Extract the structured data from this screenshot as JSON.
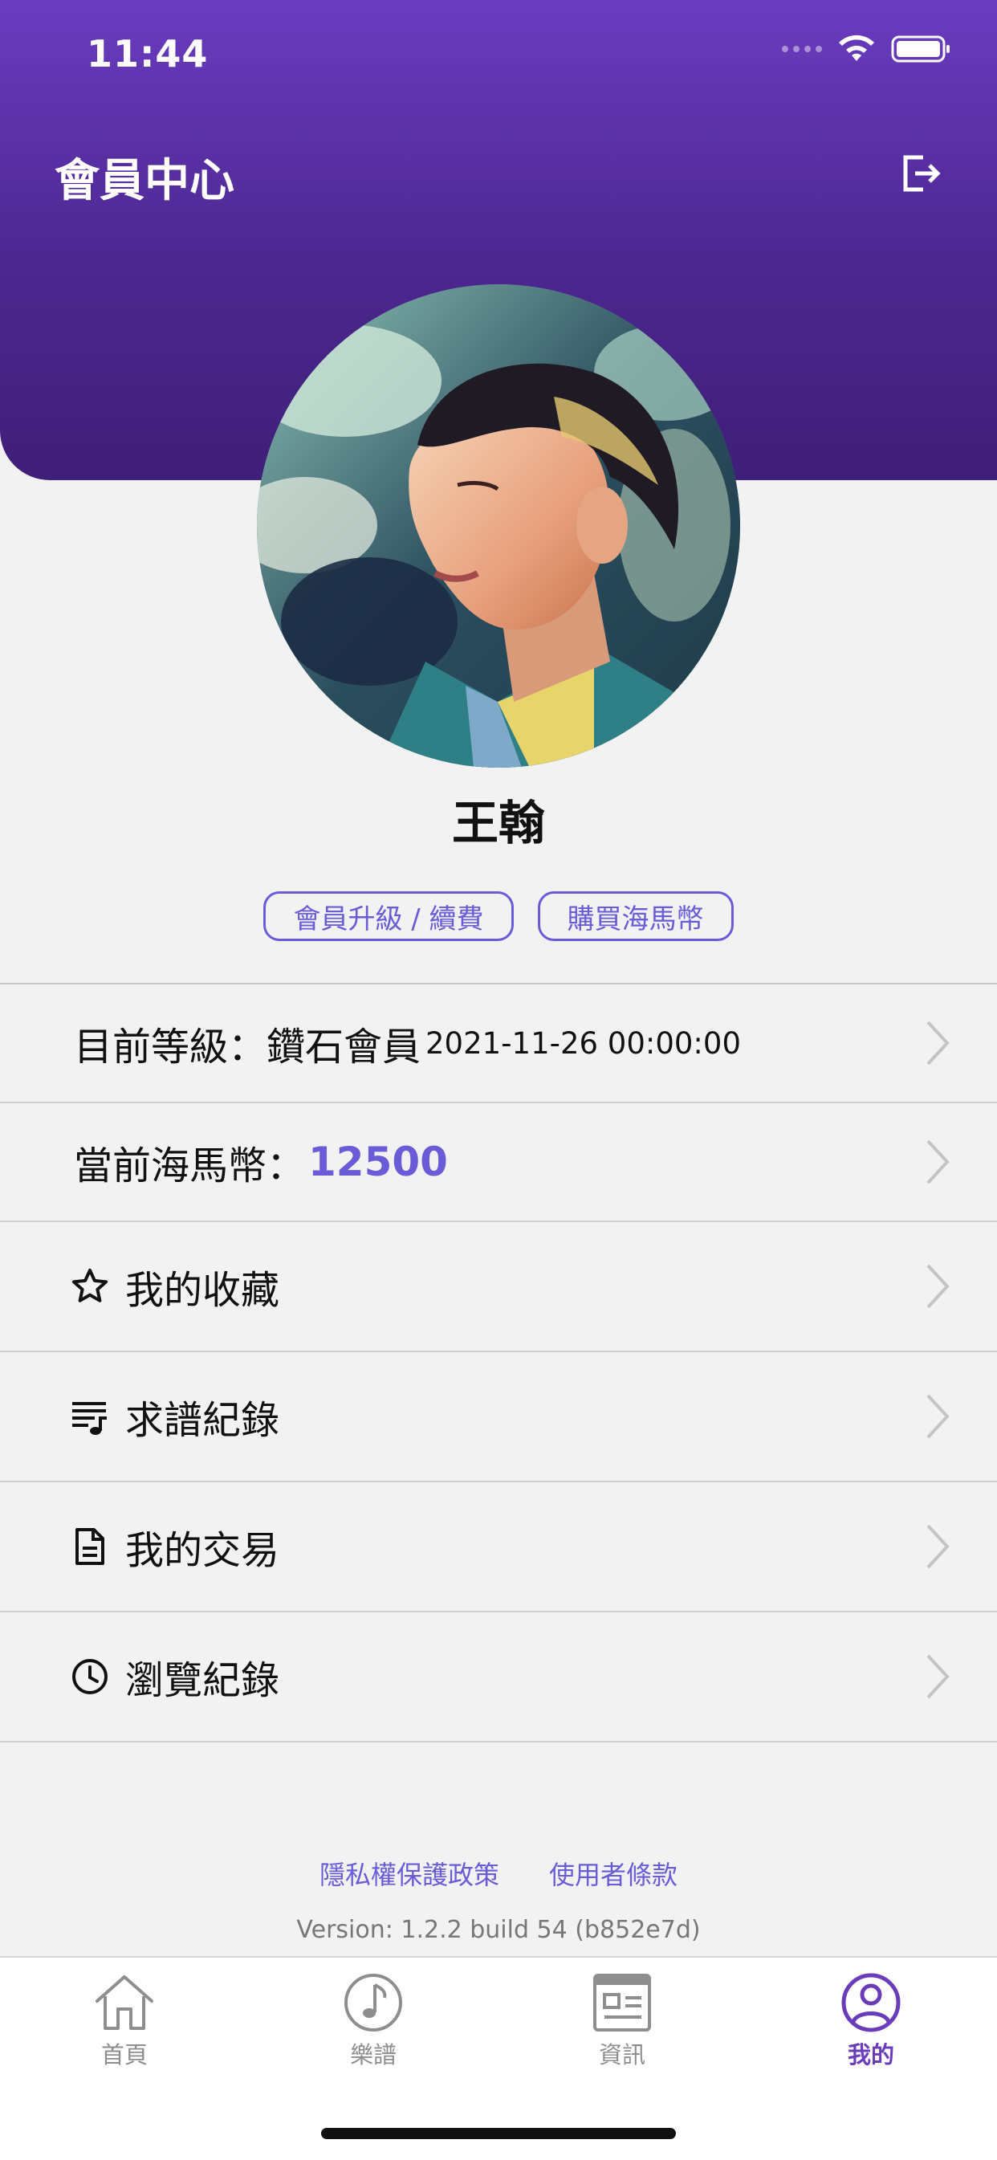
{
  "status_bar": {
    "time": "11:44"
  },
  "header": {
    "title": "會員中心",
    "logout_icon": "logout-icon",
    "gradient_colors": [
      "#6a3cc0",
      "#3f1f78"
    ]
  },
  "profile": {
    "avatar_icon": "user-avatar-image",
    "name": "王翰",
    "buttons": [
      {
        "label": "會員升級 / 續費"
      },
      {
        "label": "購買海馬幣"
      }
    ]
  },
  "info_rows": [
    {
      "label": "目前等級：鑽石會員",
      "value": "2021-11-26 00:00:00"
    },
    {
      "label": "當前海馬幣：",
      "value": "12500"
    }
  ],
  "menu_rows": [
    {
      "icon": "star-icon",
      "label": "我的收藏"
    },
    {
      "icon": "music-list-icon",
      "label": "求譜紀錄"
    },
    {
      "icon": "document-icon",
      "label": "我的交易"
    },
    {
      "icon": "clock-icon",
      "label": "瀏覽紀錄"
    }
  ],
  "footer": {
    "links": [
      "隱私權保護政策",
      "使用者條款"
    ],
    "version": "Version: 1.2.2 build 54 (b852e7d)"
  },
  "tabs": [
    {
      "icon": "home-icon",
      "label": "首頁",
      "active": false
    },
    {
      "icon": "music-note-icon",
      "label": "樂譜",
      "active": false
    },
    {
      "icon": "news-icon",
      "label": "資訊",
      "active": false
    },
    {
      "icon": "profile-icon",
      "label": "我的",
      "active": true
    }
  ],
  "colors": {
    "accent": "#6a5bd7",
    "tab_active": "#6b3cba",
    "background": "#f2f2f2"
  }
}
